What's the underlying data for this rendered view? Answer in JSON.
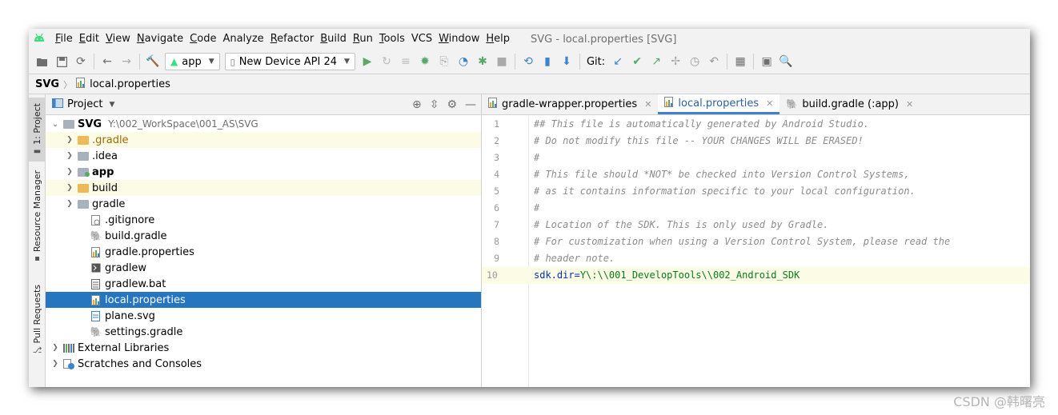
{
  "menu": {
    "items": [
      {
        "mn": "F",
        "rest": "ile"
      },
      {
        "mn": "E",
        "rest": "dit"
      },
      {
        "mn": "V",
        "rest": "iew"
      },
      {
        "mn": "N",
        "rest": "avigate"
      },
      {
        "mn": "C",
        "rest": "ode"
      },
      {
        "mn": "",
        "rest": "Analyze"
      },
      {
        "mn": "R",
        "rest": "efactor"
      },
      {
        "mn": "B",
        "rest": "uild"
      },
      {
        "mn": "R",
        "rest": "un"
      },
      {
        "mn": "T",
        "rest": "ools"
      },
      {
        "mn": "",
        "rest": "VCS"
      },
      {
        "mn": "W",
        "rest": "indow"
      },
      {
        "mn": "H",
        "rest": "elp"
      }
    ],
    "window_title": "SVG - local.properties [SVG]"
  },
  "toolbar": {
    "run_config": "app",
    "device": "New Device API 24",
    "git_label": "Git:"
  },
  "navbar": {
    "project": "SVG",
    "file": "local.properties"
  },
  "side_tabs": {
    "project": "1: Project",
    "resource_manager": "Resource Manager",
    "pull_requests": "Pull Requests"
  },
  "project_panel": {
    "title": "Project",
    "root": {
      "name": "SVG",
      "path": "Y:\\002_WorkSpace\\001_AS\\SVG"
    },
    "items": [
      {
        "name": ".gradle"
      },
      {
        "name": ".idea"
      },
      {
        "name": "app"
      },
      {
        "name": "build"
      },
      {
        "name": "gradle"
      },
      {
        "name": ".gitignore"
      },
      {
        "name": "build.gradle"
      },
      {
        "name": "gradle.properties"
      },
      {
        "name": "gradlew"
      },
      {
        "name": "gradlew.bat"
      },
      {
        "name": "local.properties"
      },
      {
        "name": "plane.svg"
      },
      {
        "name": "settings.gradle"
      }
    ],
    "external_libraries": "External Libraries",
    "scratches": "Scratches and Consoles"
  },
  "editor": {
    "tabs": [
      {
        "label": "gradle-wrapper.properties"
      },
      {
        "label": "local.properties"
      },
      {
        "label": "build.gradle (:app)"
      }
    ],
    "line_numbers": [
      "1",
      "2",
      "3",
      "4",
      "5",
      "6",
      "7",
      "8",
      "9",
      "10"
    ],
    "lines": [
      "## This file is automatically generated by Android Studio.",
      "# Do not modify this file -- YOUR CHANGES WILL BE ERASED!",
      "#",
      "# This file should *NOT* be checked into Version Control Systems,",
      "# as it contains information specific to your local configuration.",
      "#",
      "# Location of the SDK. This is only used by Gradle.",
      "# For customization when using a Version Control System, please read the",
      "# header note."
    ],
    "last_line": {
      "key": "sdk.dir",
      "eq": "=",
      "value": "Y\\:\\\\001_DevelopTools\\\\002_Android_SDK"
    }
  },
  "watermark": "CSDN @韩曙亮"
}
